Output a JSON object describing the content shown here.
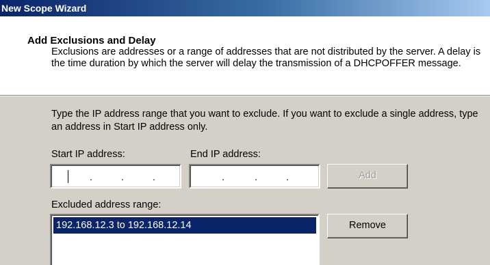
{
  "window": {
    "title": "New Scope Wizard"
  },
  "header": {
    "title": "Add Exclusions and Delay",
    "description": "Exclusions are addresses or a range of addresses that are not distributed by the server. A delay is the time duration by which the server will delay the transmission of a DHCPOFFER message."
  },
  "main": {
    "instructions": "Type the IP address range that you want to exclude. If you want to exclude a single address, type an address in Start IP address only.",
    "start_ip": {
      "label": "Start IP address:",
      "value": ""
    },
    "end_ip": {
      "label": "End IP address:",
      "value": ""
    },
    "add_button": "Add",
    "excluded_label": "Excluded address range:",
    "excluded_ranges": [
      "192.168.12.3 to 192.168.12.14"
    ],
    "remove_button": "Remove"
  },
  "colors": {
    "selection": "#0a246a",
    "titlebar_start": "#0a246a",
    "dialog_face": "#d4d0c8"
  }
}
